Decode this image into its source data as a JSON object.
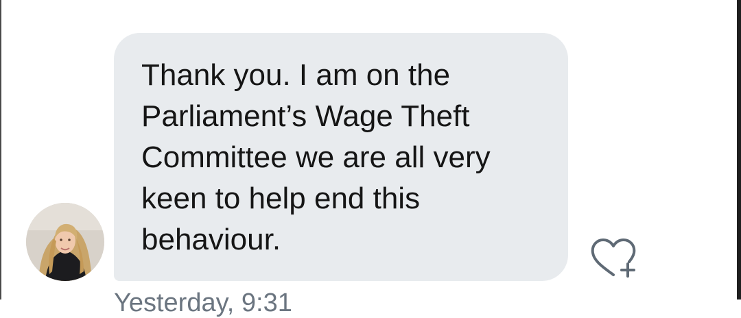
{
  "message": {
    "text": "Thank you. I am on the\nParliament’s Wage Theft\nCommittee we are all very\nkeen to help end this\nbehaviour.",
    "timestamp": "Yesterday, 9:31"
  },
  "icons": {
    "avatar": "profile-photo",
    "react": "heart-plus-icon"
  },
  "colors": {
    "bubble": "#e8ebee",
    "text": "#151515",
    "icon": "#5f6a75",
    "timestamp": "#6b7580"
  }
}
